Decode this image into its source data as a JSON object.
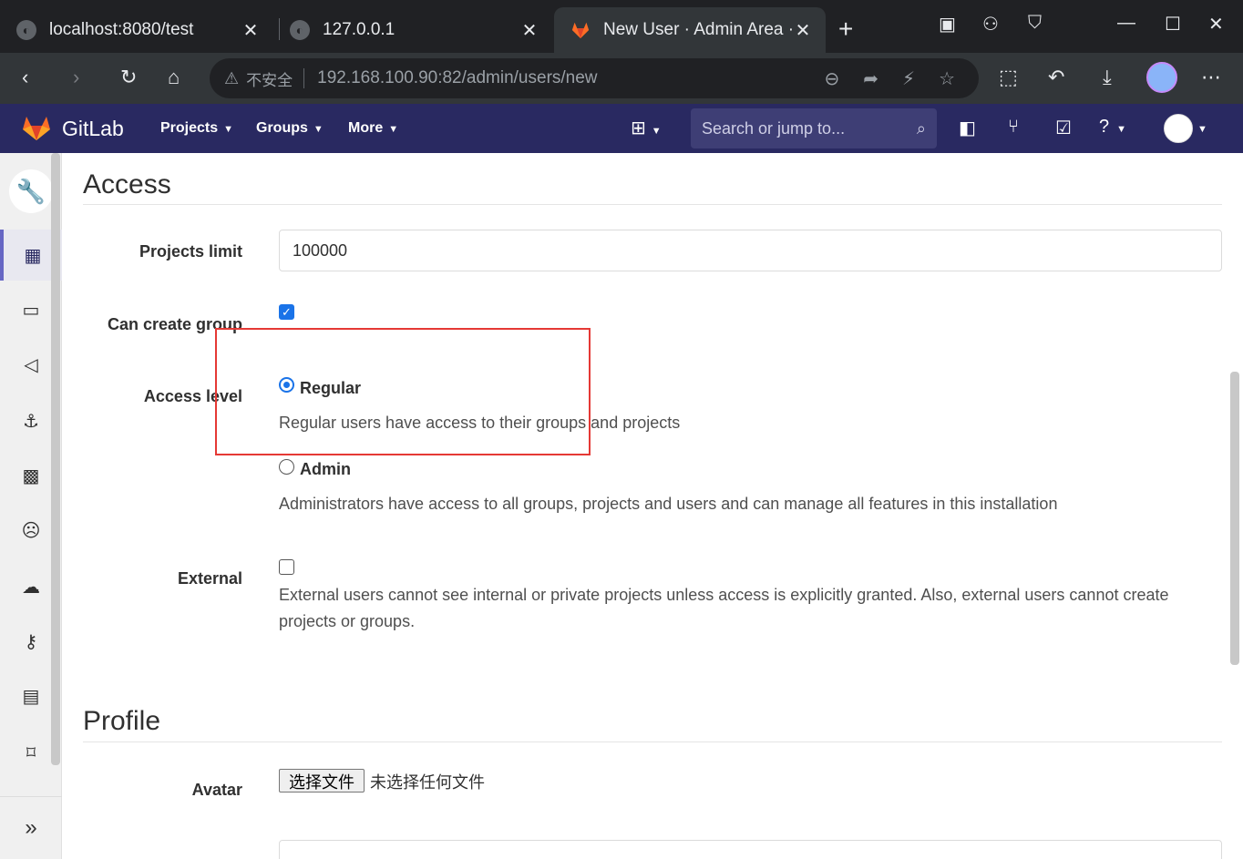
{
  "browser": {
    "tabs": [
      {
        "title": "localhost:8080/test",
        "close": "✕"
      },
      {
        "title": "127.0.0.1",
        "close": "✕"
      },
      {
        "title": "New User · Admin Area ·",
        "close": "✕"
      }
    ],
    "new_tab": "+",
    "window_controls": {
      "minimize": "—",
      "maximize": "☐",
      "close": "✕"
    },
    "address": {
      "security_label": "不安全",
      "url": "192.168.100.90:82/admin/users/new"
    }
  },
  "gitlab_nav": {
    "brand": "GitLab",
    "menu": [
      {
        "label": "Projects"
      },
      {
        "label": "Groups"
      },
      {
        "label": "More"
      }
    ],
    "search_placeholder": "Search or jump to..."
  },
  "access": {
    "title": "Access",
    "projects_limit": {
      "label": "Projects limit",
      "value": "100000"
    },
    "can_create_group": {
      "label": "Can create group",
      "checked": true
    },
    "access_level": {
      "label": "Access level",
      "options": [
        {
          "label": "Regular",
          "help": "Regular users have access to their groups and projects",
          "selected": true
        },
        {
          "label": "Admin",
          "help": "Administrators have access to all groups, projects and users and can manage all features in this installation",
          "selected": false
        }
      ]
    },
    "external": {
      "label": "External",
      "checked": false,
      "help": "External users cannot see internal or private projects unless access is explicitly granted. Also, external users cannot create projects or groups."
    }
  },
  "profile": {
    "title": "Profile",
    "avatar": {
      "label": "Avatar",
      "button": "选择文件",
      "no_file": "未选择任何文件"
    }
  },
  "colors": {
    "navbar": "#292961",
    "accent": "#1a73e8",
    "highlight_box": "#e53935"
  }
}
